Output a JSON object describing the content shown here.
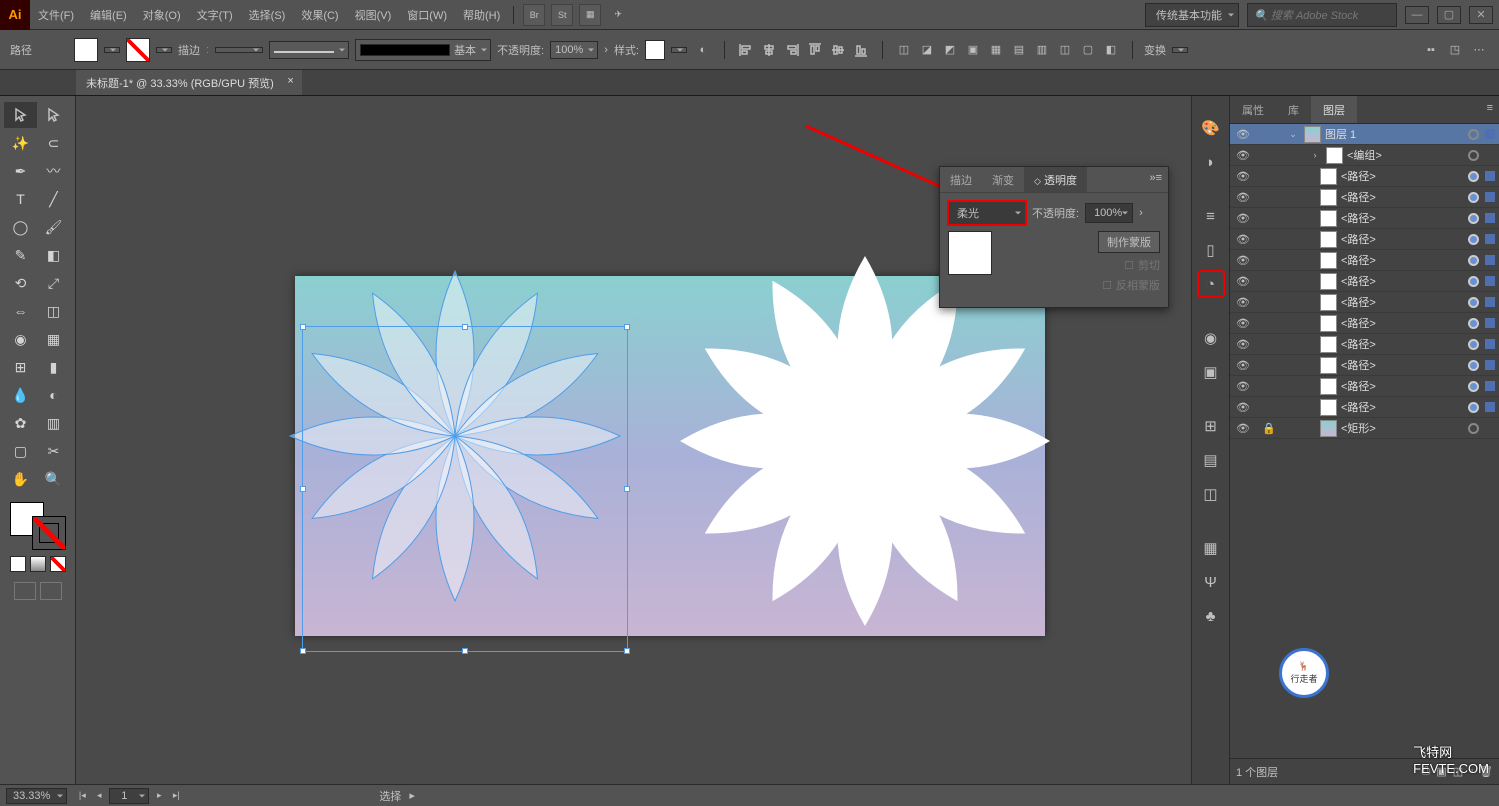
{
  "menu": {
    "items": [
      "文件(F)",
      "编辑(E)",
      "对象(O)",
      "文字(T)",
      "选择(S)",
      "效果(C)",
      "视图(V)",
      "窗口(W)",
      "帮助(H)"
    ],
    "workspace": "传统基本功能",
    "search_placeholder": "搜索 Adobe Stock"
  },
  "control": {
    "mode": "路径",
    "stroke_label": "描边",
    "stroke_pt": "",
    "profile": "基本",
    "opacity_label": "不透明度:",
    "opacity_value": "100%",
    "style_label": "样式:",
    "transform_label": "变换"
  },
  "doc": {
    "tab_title": "未标题-1* @ 33.33% (RGB/GPU 预览)"
  },
  "transparency": {
    "tabs": [
      "描边",
      "渐变",
      "透明度"
    ],
    "blend_mode": "柔光",
    "opacity_label": "不透明度:",
    "opacity_value": "100%",
    "make_mask": "制作蒙版",
    "clip": "剪切",
    "invert": "反相蒙版"
  },
  "right_tabs": [
    "属性",
    "库",
    "图层"
  ],
  "layers": {
    "top": "图层 1",
    "group": "<编组>",
    "path": "<路径>",
    "rect": "<矩形>",
    "footer": "1 个图层"
  },
  "status": {
    "zoom": "33.33%",
    "art_nav": "1",
    "mode": "选择"
  },
  "watermark": "飞特网\nFEVTE.COM"
}
